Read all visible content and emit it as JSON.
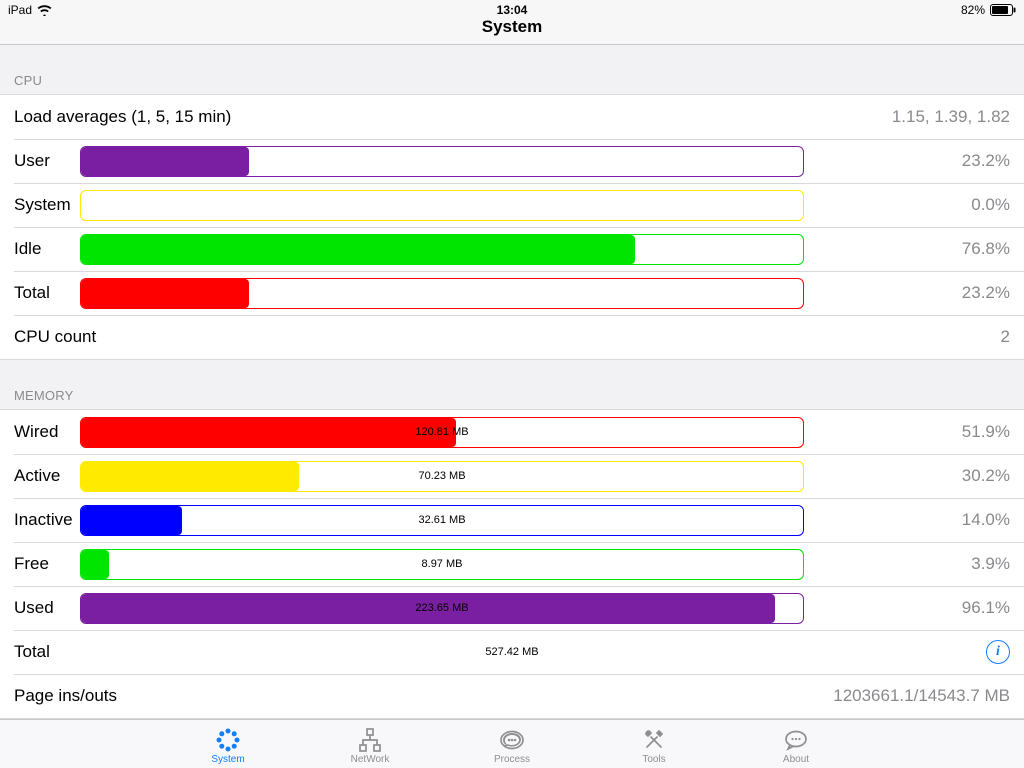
{
  "status": {
    "device": "iPad",
    "time": "13:04",
    "battery": "82%"
  },
  "header": {
    "title": "System"
  },
  "sections": {
    "cpu": {
      "header": "CPU",
      "loadavg": {
        "label": "Load averages (1, 5, 15 min)",
        "value": "1.15, 1.39, 1.82"
      },
      "bars": {
        "user": {
          "label": "User",
          "percent": 23.2,
          "value": "23.2%",
          "color": "#7b1fa2"
        },
        "system": {
          "label": "System",
          "percent": 0.0,
          "value": "0.0%",
          "color": "#ffea00"
        },
        "idle": {
          "label": "Idle",
          "percent": 76.8,
          "value": "76.8%",
          "color": "#00e500"
        },
        "total": {
          "label": "Total",
          "percent": 23.2,
          "value": "23.2%",
          "color": "#ff0000"
        }
      },
      "count": {
        "label": "CPU count",
        "value": "2"
      }
    },
    "memory": {
      "header": "MEMORY",
      "bars": {
        "wired": {
          "label": "Wired",
          "percent": 51.9,
          "value": "51.9%",
          "text": "120.81 MB",
          "color": "#ff0000"
        },
        "active": {
          "label": "Active",
          "percent": 30.2,
          "value": "30.2%",
          "text": "70.23 MB",
          "color": "#ffea00"
        },
        "inactive": {
          "label": "Inactive",
          "percent": 14.0,
          "value": "14.0%",
          "text": "32.61 MB",
          "color": "#0000ff"
        },
        "free": {
          "label": "Free",
          "percent": 3.9,
          "value": "3.9%",
          "text": "8.97 MB",
          "color": "#00e500"
        },
        "used": {
          "label": "Used",
          "percent": 96.1,
          "value": "96.1%",
          "text": "223.65 MB",
          "color": "#7b1fa2"
        }
      },
      "total": {
        "label": "Total",
        "value": "527.42 MB"
      },
      "pageio": {
        "label": "Page ins/outs",
        "value": "1203661.1/14543.7 MB"
      }
    }
  },
  "tabs": {
    "system": {
      "label": "System",
      "active": true
    },
    "network": {
      "label": "NetWork",
      "active": false
    },
    "process": {
      "label": "Process",
      "active": false
    },
    "tools": {
      "label": "Tools",
      "active": false
    },
    "about": {
      "label": "About",
      "active": false
    }
  },
  "chart_data": [
    {
      "type": "bar",
      "title": "CPU",
      "orientation": "horizontal",
      "xlabel": "",
      "ylabel": "",
      "xlim": [
        0,
        100
      ],
      "categories": [
        "User",
        "System",
        "Idle",
        "Total"
      ],
      "values": [
        23.2,
        0.0,
        76.8,
        23.2
      ],
      "unit": "%"
    },
    {
      "type": "bar",
      "title": "Memory",
      "orientation": "horizontal",
      "xlabel": "",
      "ylabel": "",
      "xlim": [
        0,
        100
      ],
      "categories": [
        "Wired",
        "Active",
        "Inactive",
        "Free",
        "Used"
      ],
      "values": [
        51.9,
        30.2,
        14.0,
        3.9,
        96.1
      ],
      "value_labels_mb": [
        120.81,
        70.23,
        32.61,
        8.97,
        223.65
      ],
      "unit": "%"
    }
  ]
}
